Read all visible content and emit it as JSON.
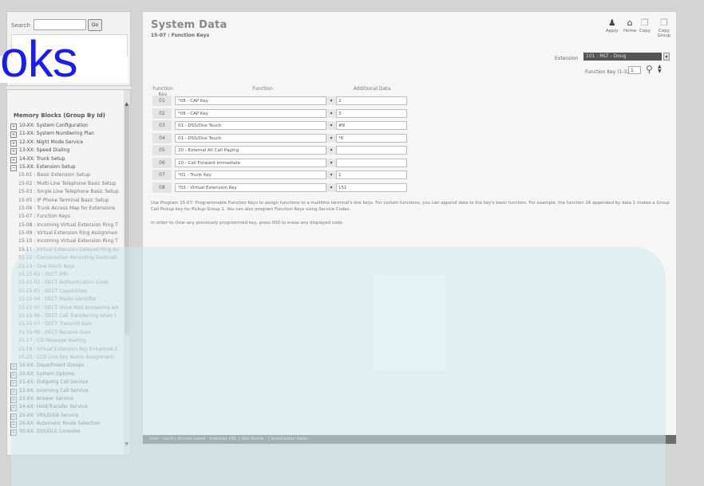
{
  "logo": {
    "text": "oks"
  },
  "search": {
    "label": "Search",
    "value": "",
    "go_label": "Go"
  },
  "tree": {
    "title": "Memory Blocks (Group By Id)",
    "items": [
      {
        "label": "10-XX: System Configuration",
        "type": "group"
      },
      {
        "label": "11-XX: System Numbering Plan",
        "type": "group"
      },
      {
        "label": "12-XX: Night Mode Service",
        "type": "group"
      },
      {
        "label": "13-XX: Speed Dialing",
        "type": "group"
      },
      {
        "label": "14-XX: Trunk Setup",
        "type": "group"
      },
      {
        "label": "15-XX: Extension Setup",
        "type": "open"
      },
      {
        "label": "15-01 : Basic Extension Setup",
        "type": "sub"
      },
      {
        "label": "15-02 : Multi-Line Telephone Basic Setup",
        "type": "sub"
      },
      {
        "label": "15-03 : Single Line Telephone Basic Setup",
        "type": "sub"
      },
      {
        "label": "15-05 : IP Phone Terminal Basic Setup",
        "type": "sub"
      },
      {
        "label": "15-06 : Trunk Access Map for Extensions",
        "type": "sub"
      },
      {
        "label": "15-07 : Function Keys",
        "type": "sub"
      },
      {
        "label": "15-08 : Incoming Virtual Extension Ring T",
        "type": "sub"
      },
      {
        "label": "15-09 : Virtual Extension Ring Assignmen",
        "type": "sub"
      },
      {
        "label": "15-10 : Incoming Virtual Extension Ring T",
        "type": "sub"
      },
      {
        "label": "15-11 : Virtual Extension Delayed Ring As",
        "type": "sub"
      },
      {
        "label": "15-12 : Conversation Recording Destinati",
        "type": "sub"
      },
      {
        "label": "15-14 : One-touch Keys",
        "type": "sub"
      },
      {
        "label": "15-15-01 : DECT IPEI",
        "type": "sub"
      },
      {
        "label": "15-15-02 : DECT Authentication Code",
        "type": "sub"
      },
      {
        "label": "15-15-03 : DECT Capabilities",
        "type": "sub"
      },
      {
        "label": "15-15-04 : DECT Model Identifier",
        "type": "sub"
      },
      {
        "label": "15-15-05 : DECT Voice Mail Answering wh",
        "type": "sub"
      },
      {
        "label": "15-15-06 : DECT Call Transferring when t",
        "type": "sub"
      },
      {
        "label": "15-15-07 : DECT Transmit Gain",
        "type": "sub"
      },
      {
        "label": "15-15-08 : DECT Receive Gain",
        "type": "sub"
      },
      {
        "label": "15-17 : CO Message Waiting",
        "type": "sub"
      },
      {
        "label": "15-18 : Virtual Extension Key Enhanced C",
        "type": "sub"
      },
      {
        "label": "15-20 : LCD Line Key Name Assignment",
        "type": "sub"
      },
      {
        "label": "16-XX: Department Groups",
        "type": "group"
      },
      {
        "label": "20-XX: System Options",
        "type": "group"
      },
      {
        "label": "21-XX: Outgoing Call Service",
        "type": "group"
      },
      {
        "label": "22-XX: Incoming Call Service",
        "type": "group"
      },
      {
        "label": "23-XX: Answer Service",
        "type": "group"
      },
      {
        "label": "24-XX: Hold/Transfer Service",
        "type": "group"
      },
      {
        "label": "25-XX: VRS/DISA Service",
        "type": "group"
      },
      {
        "label": "26-XX: Automatic Route Selection",
        "type": "group"
      },
      {
        "label": "30-XX: DSS/DLS Consoles",
        "type": "group"
      }
    ]
  },
  "main": {
    "title": "System Data",
    "subtitle": "15-07 : Function Keys",
    "toolbar": {
      "apply": "Apply",
      "home": "Home",
      "copy": "Copy",
      "copy_group": "Copy Group"
    },
    "extension_label": "Extension",
    "extension_value": "101 : MLT - Doug",
    "function_key_label": "Function Key (1-32)",
    "function_key_value": "1",
    "columns": {
      "key": "Function Key",
      "function": "Function",
      "additional": "Additional Data"
    },
    "rows": [
      {
        "key": "01",
        "function": "*08 - CAP Key",
        "data": "2"
      },
      {
        "key": "02",
        "function": "*08 - CAP Key",
        "data": "3"
      },
      {
        "key": "03",
        "function": "01 - DSS/One Touch",
        "data": "#8"
      },
      {
        "key": "04",
        "function": "01 - DSS/One Touch",
        "data": "*6"
      },
      {
        "key": "05",
        "function": "20 - External All Call Paging",
        "data": ""
      },
      {
        "key": "06",
        "function": "10 - Call Forward Immediate",
        "data": ""
      },
      {
        "key": "07",
        "function": "*01 - Trunk Key",
        "data": "1"
      },
      {
        "key": "08",
        "function": "*03 - Virtual Extension Key",
        "data": "151"
      }
    ],
    "description": "Use Program 15-07: Programmable Function Keys to assign functions to a multiline terminal's line keys. For certain functions, you can append data to the key's basic function. For example, the function 26 appended by data 1 makes a Group Call Pickup key for Pickup Group 1. You can also program Function Keys using Service Codes.",
    "description2": "In order to clear any previously programmed key, press 000 to erase any displayed code.",
    "status": "User : tech  |  Access Level : Installer (IN)  |  Site Name :  |  Installation Date :"
  }
}
